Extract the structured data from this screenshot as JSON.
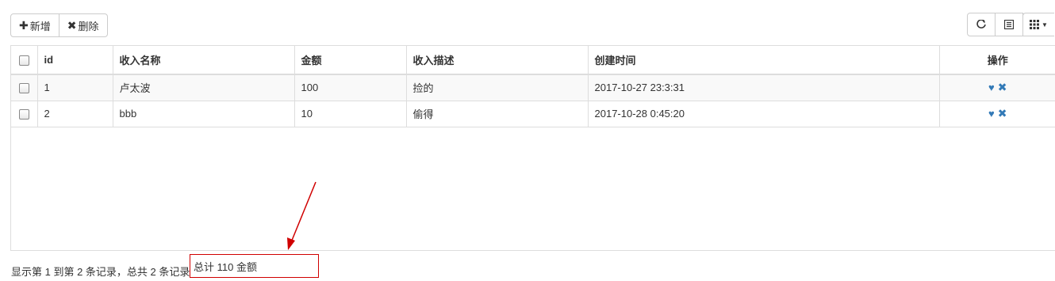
{
  "toolbar": {
    "add_label": "新增",
    "add_icon": "plus-icon",
    "delete_label": "删除",
    "delete_icon": "remove-icon",
    "refresh_icon": "refresh-icon",
    "toggle_view_icon": "list-alt-icon",
    "columns_icon": "th-icon"
  },
  "table": {
    "headers": [
      "id",
      "收入名称",
      "金额",
      "收入描述",
      "创建时间",
      "操作"
    ],
    "rows": [
      {
        "id": "1",
        "name": "卢太波",
        "amount": "100",
        "desc": "捡的",
        "created": "2017-10-27 23:3:31"
      },
      {
        "id": "2",
        "name": "bbb",
        "amount": "10",
        "desc": "偷得",
        "created": "2017-10-28 0:45:20"
      }
    ]
  },
  "footer": {
    "pagination_info": "显示第 1 到第 2 条记录，总共 2 条记录",
    "total_text": "总计 110 金额"
  },
  "colors": {
    "accent": "#337ab7",
    "annotation_red": "#d00000",
    "border": "#dddddd"
  }
}
